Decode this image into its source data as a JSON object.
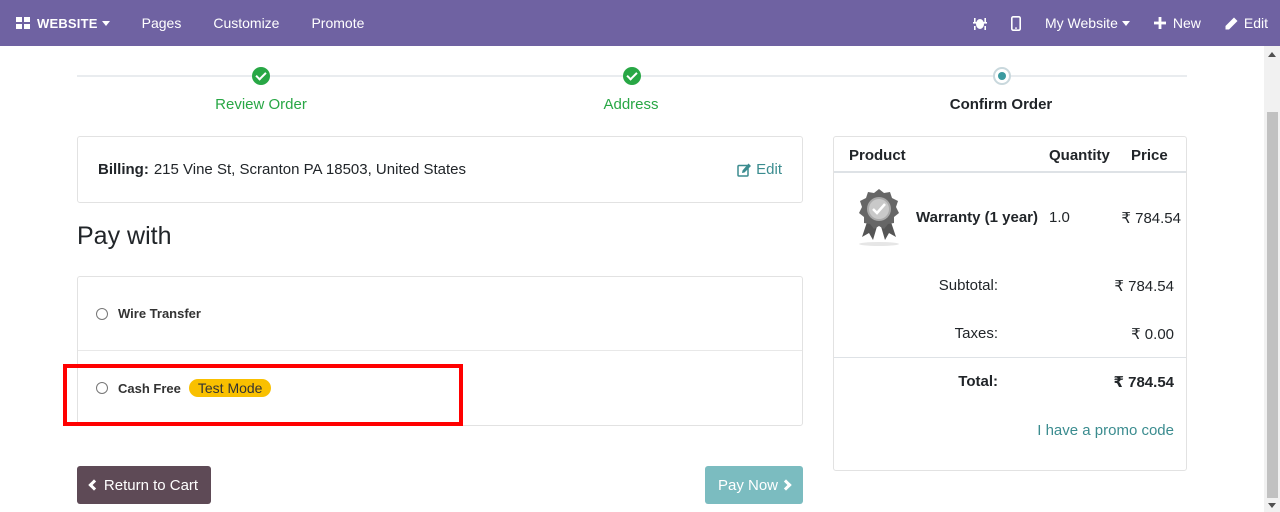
{
  "topbar": {
    "website_label": "WEBSITE",
    "pages_label": "Pages",
    "customize_label": "Customize",
    "promote_label": "Promote",
    "my_website_label": "My Website",
    "new_label": "New",
    "edit_label": "Edit",
    "color": "#6f62a2"
  },
  "steps": [
    {
      "label": "Review Order",
      "state": "done"
    },
    {
      "label": "Address",
      "state": "done"
    },
    {
      "label": "Confirm Order",
      "state": "current"
    }
  ],
  "billing": {
    "label": "Billing:",
    "address": "215 Vine St, Scranton PA 18503, United States",
    "edit_label": "Edit"
  },
  "pay_with_title": "Pay with",
  "payment_methods": [
    {
      "label": "Wire Transfer"
    },
    {
      "label": "Cash Free",
      "badge": "Test Mode"
    }
  ],
  "buttons": {
    "return_label": "Return to Cart",
    "pay_label": "Pay Now"
  },
  "summary": {
    "headers": {
      "product": "Product",
      "quantity": "Quantity",
      "price": "Price"
    },
    "item": {
      "name": "Warranty (1 year)",
      "quantity": "1.0",
      "price": "₹ 784.54",
      "icon": "certificate-badge-icon"
    },
    "subtotal_label": "Subtotal:",
    "subtotal_value": "₹ 784.54",
    "taxes_label": "Taxes:",
    "taxes_value": "₹ 0.00",
    "total_label": "Total:",
    "total_value": "₹ 784.54",
    "promo_label": "I have a promo code"
  }
}
